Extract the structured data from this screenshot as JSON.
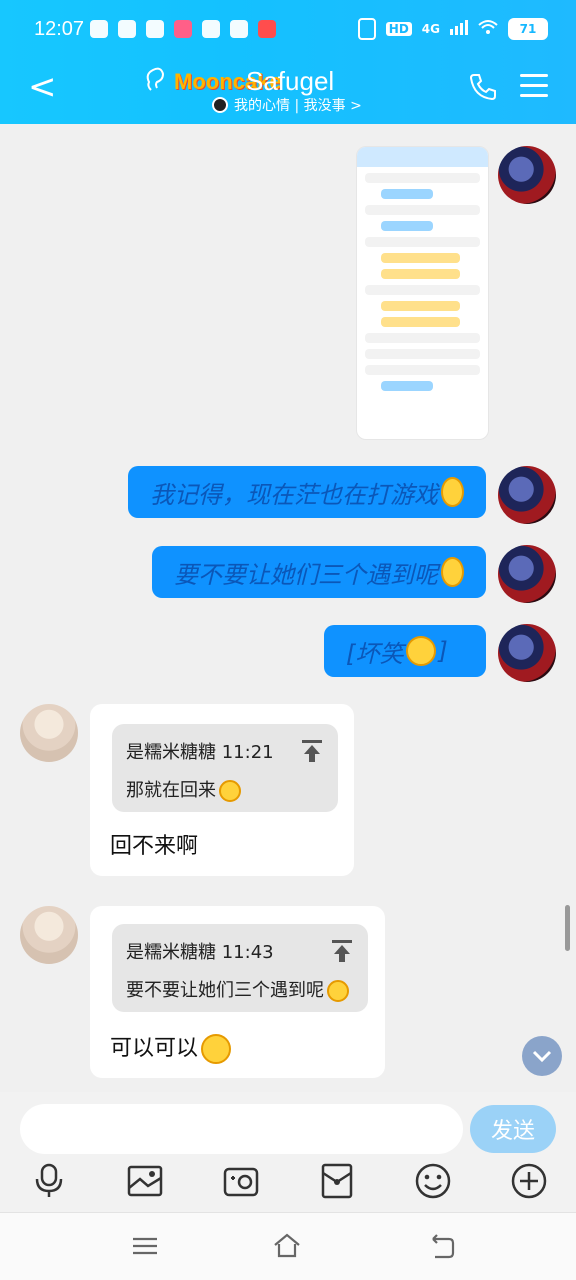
{
  "status": {
    "time": "12:07",
    "network": "4G",
    "hd": "HD",
    "battery": "71"
  },
  "header": {
    "back_label": "<",
    "brand_logo": "Mooncake",
    "title": "Safugel",
    "subtitle": "我的心情 | 我没事 >"
  },
  "messages": [
    {
      "side": "me",
      "type": "image",
      "text": ""
    },
    {
      "side": "me",
      "type": "text",
      "text": "我记得，现在茫也在打游戏"
    },
    {
      "side": "me",
      "type": "text",
      "text": "要不要让她们三个遇到呢"
    },
    {
      "side": "me",
      "type": "text",
      "text": "[坏笑"
    },
    {
      "side": "friend",
      "type": "quote",
      "quote_title": "是糯米糖糖 11:21",
      "quote_body": "那就在回来",
      "reply": "回不来啊"
    },
    {
      "side": "friend",
      "type": "quote",
      "quote_title": "是糯米糖糖 11:43",
      "quote_body": "要不要让她们三个遇到呢",
      "reply": "可以可以"
    }
  ],
  "input": {
    "value": "",
    "placeholder": "",
    "send_label": "发送"
  },
  "toolbar_icons": [
    "microphone-icon",
    "image-icon",
    "camera-icon",
    "red-envelope-icon",
    "emoji-icon",
    "plus-icon"
  ],
  "nav_icons": [
    "menu-icon",
    "home-icon",
    "back-icon"
  ],
  "colors": {
    "header": "#17c7ff",
    "bubble_blue": "#0f92ff",
    "send_button": "#9bd2f7"
  }
}
